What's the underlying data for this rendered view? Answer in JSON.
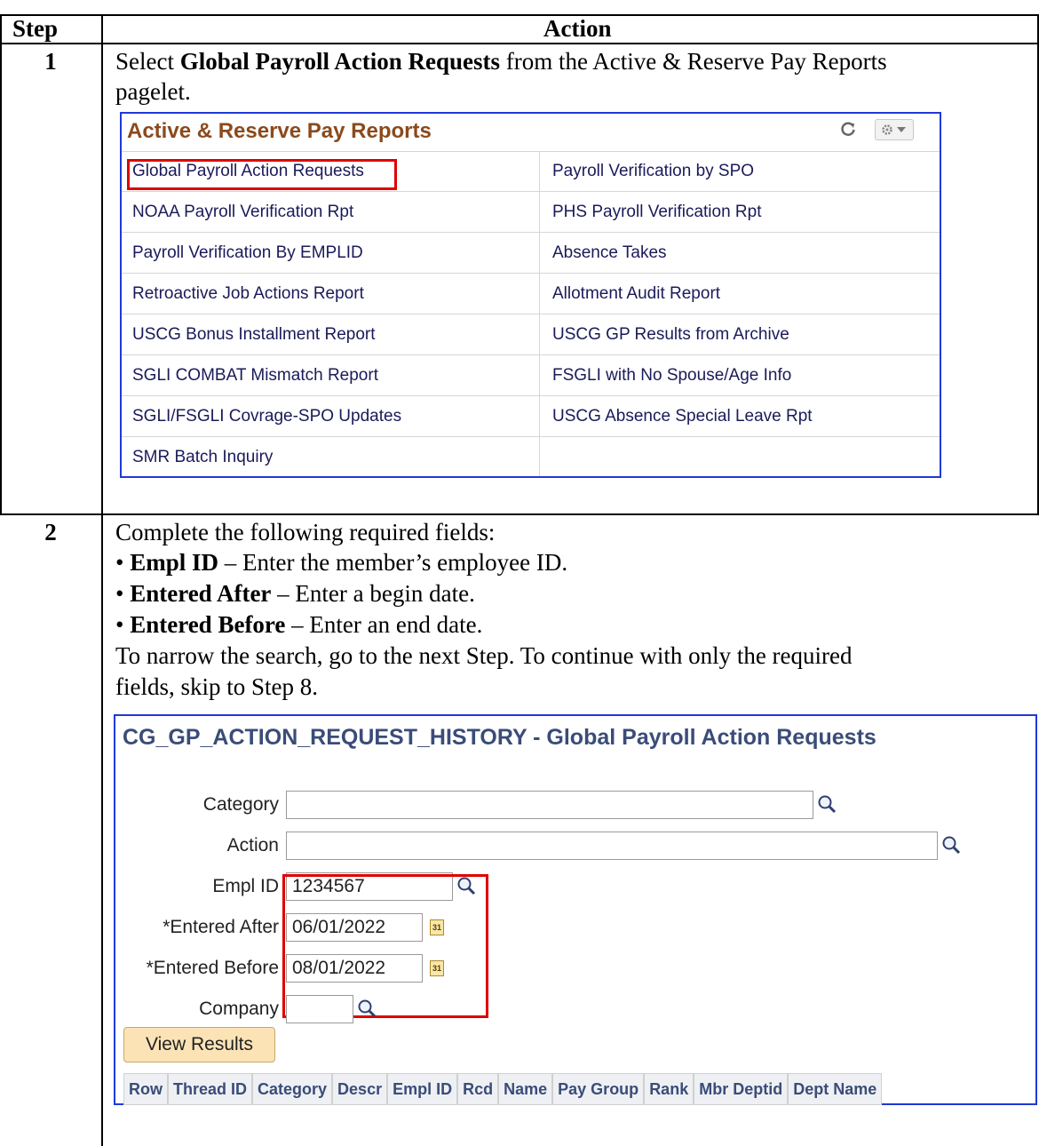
{
  "table": {
    "header_step": "Step",
    "header_action": "Action"
  },
  "step1": {
    "number": "1",
    "text_pre": "Select ",
    "text_bold": "Global Payroll Action Requests",
    "text_post": " from the Active & Reserve Pay Reports",
    "text_line2": "pagelet."
  },
  "pagelet": {
    "title": "Active & Reserve Pay Reports",
    "rows": [
      {
        "left": "Global Payroll Action Requests",
        "right": "Payroll Verification by SPO"
      },
      {
        "left": "NOAA Payroll Verification Rpt",
        "right": "PHS Payroll Verification Rpt"
      },
      {
        "left": "Payroll Verification By EMPLID",
        "right": "Absence Takes"
      },
      {
        "left": "Retroactive Job Actions Report",
        "right": "Allotment Audit Report"
      },
      {
        "left": "USCG Bonus Installment Report",
        "right": "USCG GP Results from Archive"
      },
      {
        "left": "SGLI COMBAT Mismatch Report",
        "right": "FSGLI with No Spouse/Age Info"
      },
      {
        "left": "SGLI/FSGLI Covrage-SPO Updates",
        "right": "USCG Absence Special Leave Rpt"
      },
      {
        "left": "SMR Batch Inquiry",
        "right": ""
      }
    ]
  },
  "step2": {
    "number": "2",
    "intro": "Complete the following required fields:",
    "bullets": [
      {
        "bold": "Empl ID",
        "rest": " – Enter the member’s employee ID."
      },
      {
        "bold": "Entered After",
        "rest": " – Enter a begin date."
      },
      {
        "bold": "Entered Before",
        "rest": " – Enter an end date."
      }
    ],
    "note_line1": "To narrow the search, go to the next Step. To continue with only the required",
    "note_line2": "fields, skip to Step 8."
  },
  "form": {
    "title": "CG_GP_ACTION_REQUEST_HISTORY - Global Payroll Action Requests",
    "fields": {
      "category_label": "Category",
      "category_value": "",
      "action_label": "Action",
      "action_value": "",
      "emplid_label": "Empl ID",
      "emplid_value": "1234567",
      "after_label": "*Entered After",
      "after_value": "06/01/2022",
      "before_label": "*Entered Before",
      "before_value": "08/01/2022",
      "company_label": "Company",
      "company_value": ""
    },
    "calendar_glyph": "31",
    "button_label": "View Results",
    "grid_columns": [
      "Row",
      "Thread ID",
      "Category",
      "Descr",
      "Empl ID",
      "Rcd",
      "Name",
      "Pay Group",
      "Rank",
      "Mbr Deptid",
      "Dept Name"
    ]
  },
  "colors": {
    "pagelet_border": "#1f39d8",
    "highlight": "#e00000",
    "pagelet_title": "#8b4a1c",
    "form_title": "#3a4c78"
  }
}
